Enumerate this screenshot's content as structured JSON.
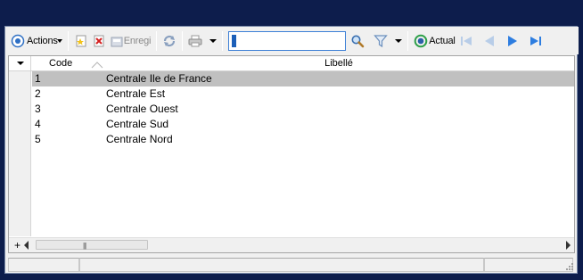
{
  "toolbar": {
    "actions_label": "Actions",
    "save_label": "Enregi",
    "search_value": "1",
    "actual_label": "Actual"
  },
  "grid": {
    "columns": [
      "Code",
      "Libellé"
    ],
    "rows": [
      {
        "code": "1",
        "libelle": "Centrale Ile de France",
        "selected": true
      },
      {
        "code": "2",
        "libelle": "Centrale Est",
        "selected": false
      },
      {
        "code": "3",
        "libelle": "Centrale Ouest",
        "selected": false
      },
      {
        "code": "4",
        "libelle": "Centrale Sud",
        "selected": false
      },
      {
        "code": "5",
        "libelle": "Centrale Nord",
        "selected": false
      }
    ],
    "footer_plus": "+"
  },
  "icons": [
    "actions-icon",
    "new-record-icon",
    "delete-icon",
    "save-icon",
    "refresh-icon",
    "print-icon",
    "dropdown-icon",
    "search-icon",
    "filter-icon",
    "actual-icon",
    "first-icon",
    "previous-icon",
    "next-icon",
    "last-icon"
  ],
  "colors": {
    "background": "#0d1d4c",
    "selected_row": "#c0c0c0",
    "accent_blue": "#2d7de0"
  }
}
